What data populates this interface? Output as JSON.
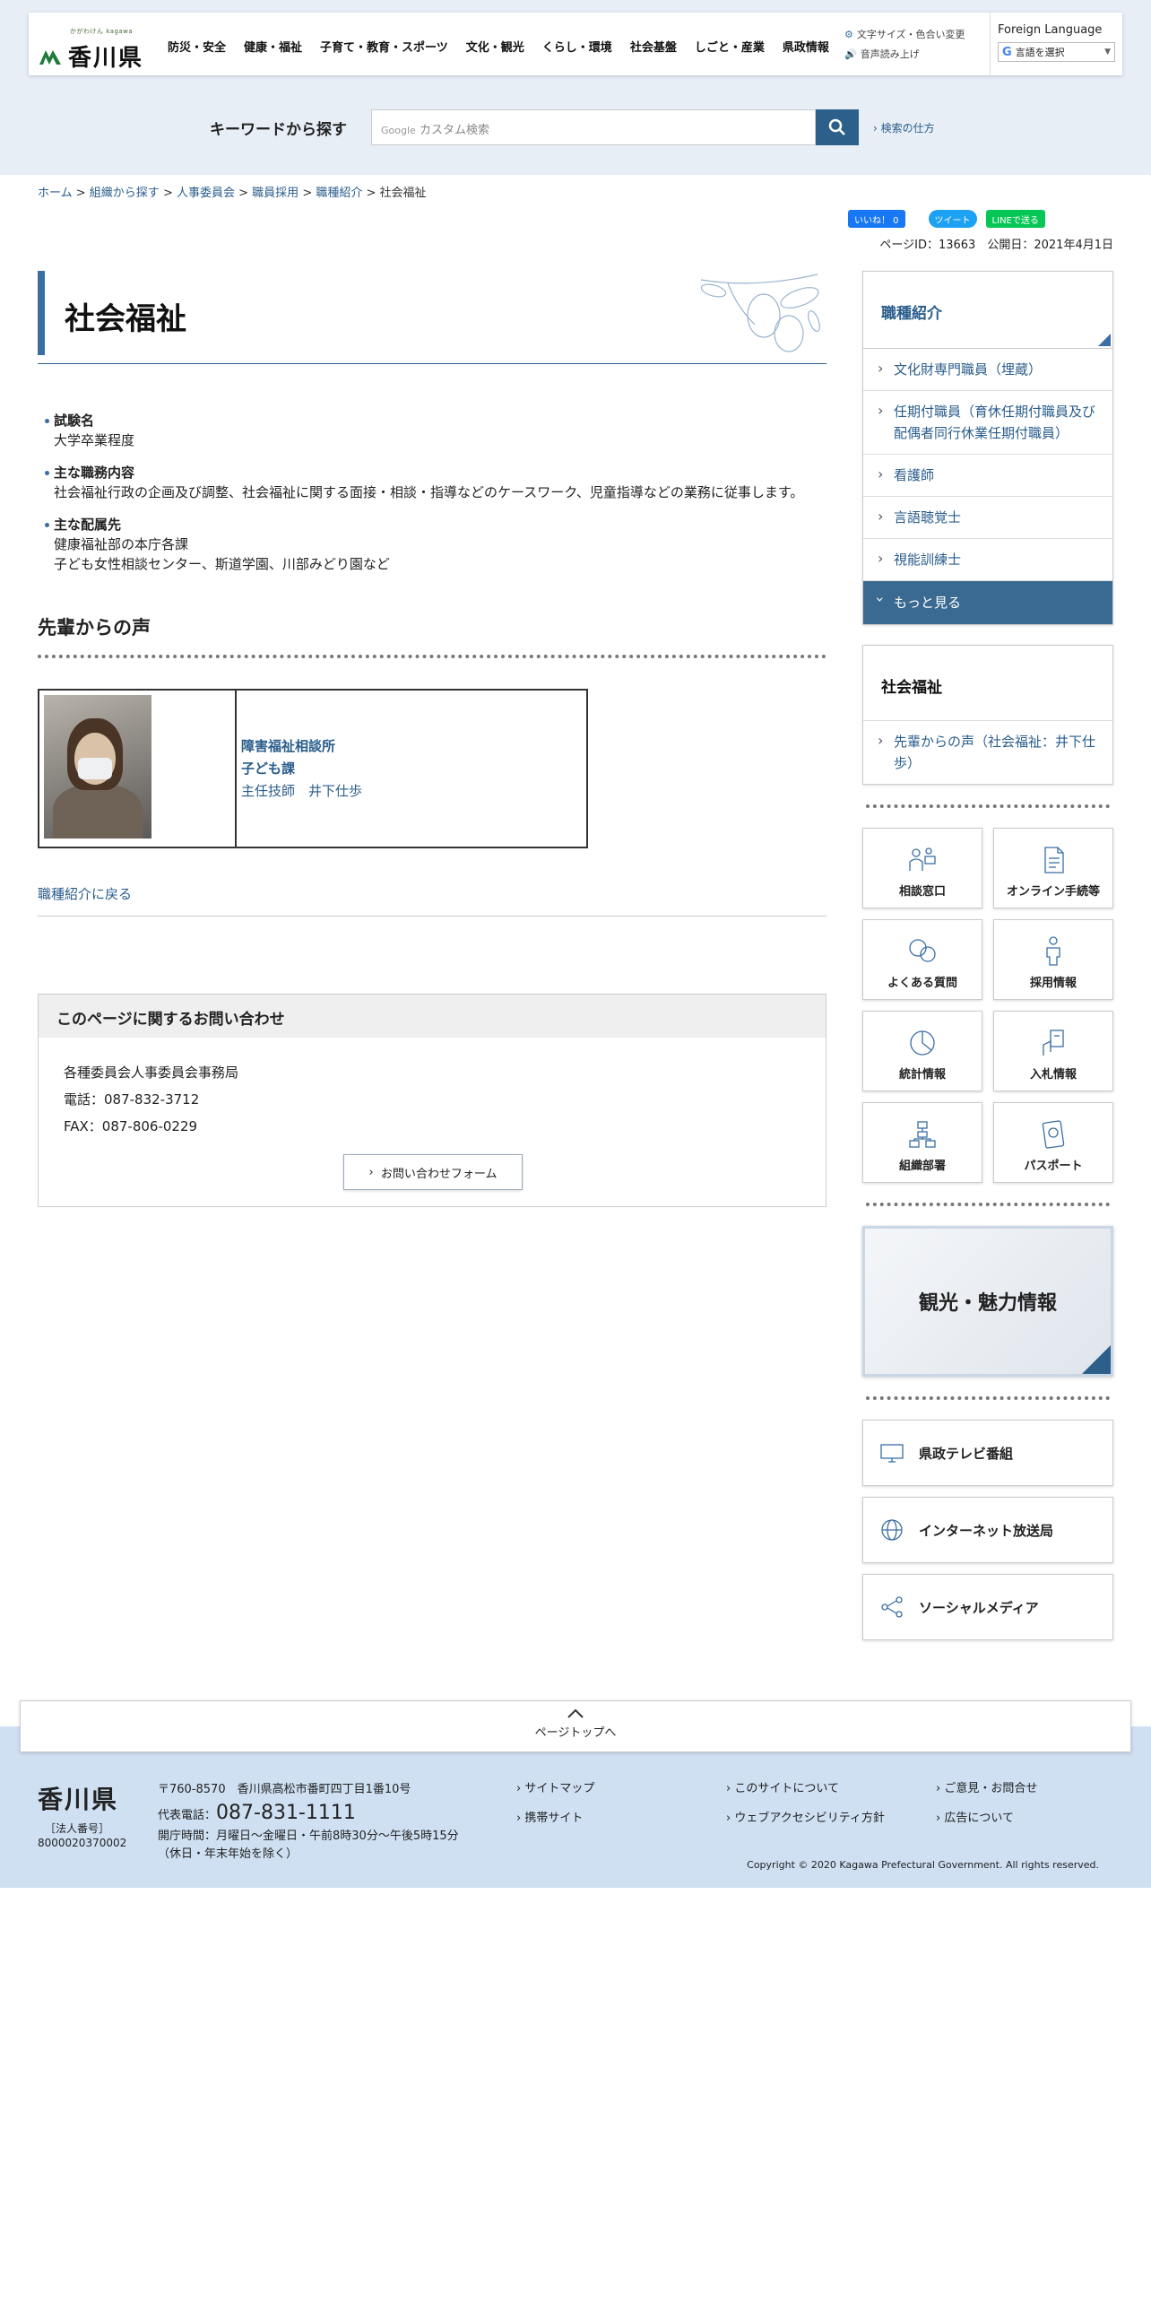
{
  "header": {
    "logo_sub": "かがわけん kagawa",
    "logo_name": "香川県",
    "nav": [
      "防災・安全",
      "健康・福祉",
      "子育て・教育・スポーツ",
      "文化・観光",
      "くらし・環境",
      "社会基盤",
      "しごと・産業",
      "県政情報"
    ],
    "tool_font": "文字サイズ・色合い変更",
    "tool_voice": "音声読み上げ",
    "lang_title": "Foreign Language",
    "lang_select": "言語を選択",
    "lang_arrow": "▼"
  },
  "search": {
    "label": "キーワードから探す",
    "google": "Google",
    "placeholder": "カスタム検索",
    "how": "検索の仕方"
  },
  "breadcrumb": {
    "items": [
      "ホーム",
      "組織から探す",
      "人事委員会",
      "職員採用",
      "職種紹介"
    ],
    "current": "社会福祉",
    "sep": " > "
  },
  "social": {
    "like": "いいね！ 0",
    "tweet": "ツイート",
    "line": "LINEで送る"
  },
  "meta": {
    "page_id": "ページID：13663",
    "published": "公開日：2021年4月1日"
  },
  "main": {
    "title": "社会福祉",
    "details": [
      {
        "key": "試験名",
        "value": "大学卒業程度"
      },
      {
        "key": "主な職務内容",
        "value": "社会福祉行政の企画及び調整、社会福祉に関する面接・相談・指導などのケースワーク、児童指導などの業務に従事します。"
      },
      {
        "key": "主な配属先",
        "value": "健康福祉部の本庁各課\n子ども女性相談センター、斯道学園、川部みどり園など"
      }
    ],
    "voice_heading": "先輩からの声",
    "voice_link1": "障害福祉相談所",
    "voice_link2": "子ども課",
    "voice_link3": "主任技師　井下仕歩",
    "back_link": "職種紹介に戻る",
    "inquiry_title": "このページに関するお問い合わせ",
    "inquiry_org": "各種委員会人事委員会事務局",
    "inquiry_tel": "電話：087-832-3712",
    "inquiry_fax": "FAX：087-806-0229",
    "inquiry_form": "お問い合わせフォーム"
  },
  "sidebar": {
    "section_title": "職種紹介",
    "items": [
      "文化財専門職員（埋蔵）",
      "任期付職員（育休任期付職員及び配偶者同行休業任期付職員）",
      "看護師",
      "言語聴覚士",
      "視能訓練士"
    ],
    "more": "もっと見る",
    "sub_title": "社会福祉",
    "sub_items": [
      "先輩からの声（社会福祉：井下仕歩）"
    ],
    "grid": [
      "相談窓口",
      "オンライン手続等",
      "よくある質問",
      "採用情報",
      "統計情報",
      "入札情報",
      "組織部署",
      "パスポート"
    ],
    "banner": "観光・魅力情報",
    "links": [
      "県政テレビ番組",
      "インターネット放送局",
      "ソーシャルメディア"
    ]
  },
  "pagetop": "ページトップへ",
  "footer": {
    "name": "香川県",
    "corp_label": "［法人番号］",
    "corp_no": "8000020370002",
    "address": "〒760-8570　香川県高松市番町四丁目1番10号",
    "tel_label": "代表電話：",
    "tel": "087-831-1111",
    "hours": "開庁時間：月曜日～金曜日・午前8時30分～午後5時15分",
    "hours_note": "（休日・年末年始を除く）",
    "links": [
      "サイトマップ",
      "このサイトについて",
      "ご意見・お問合せ",
      "携帯サイト",
      "ウェブアクセシビリティ方針",
      "広告について"
    ],
    "copyright": "Copyright © 2020 Kagawa Prefectural Government. All rights reserved."
  },
  "colors": {
    "accent": "#3a6ea5",
    "footer_bg": "#cfe0f3",
    "band_bg": "#e8eef6"
  }
}
